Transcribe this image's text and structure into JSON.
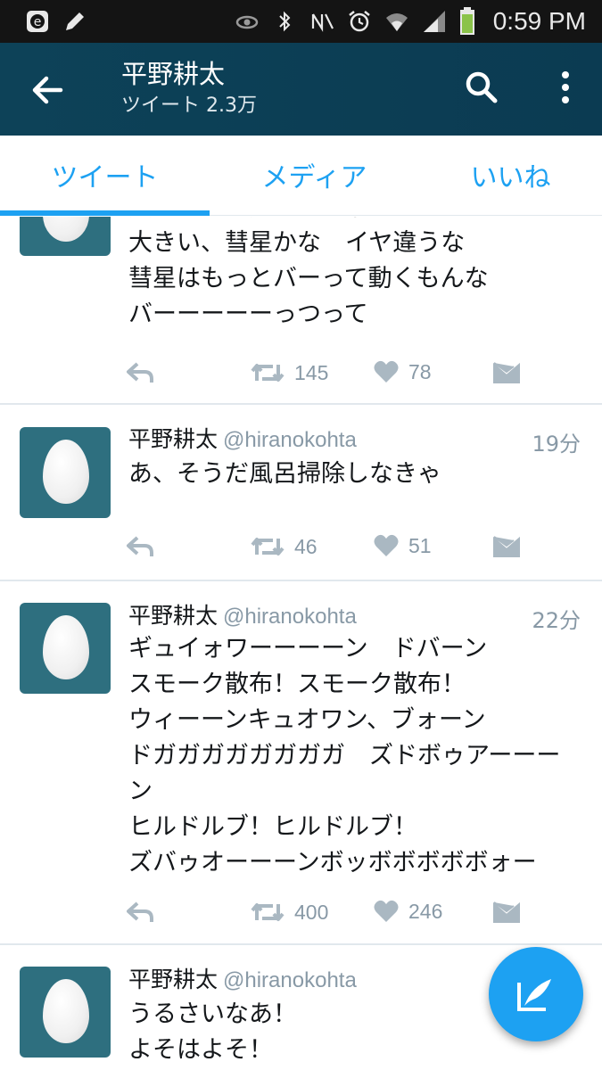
{
  "status_bar": {
    "time": "0:59 PM",
    "icons": [
      "e-app-icon",
      "pencil-icon",
      "eye-icon",
      "bluetooth-icon",
      "nfc-icon",
      "alarm-icon",
      "wifi-icon",
      "signal-icon",
      "battery-icon"
    ],
    "battery_color": "#8bc34a"
  },
  "app_bar": {
    "title": "平野耕太",
    "subtitle": "ツイート 2.3万",
    "background": "#0d4258"
  },
  "tabs": [
    {
      "label": "ツイート",
      "selected": true
    },
    {
      "label": "メディア",
      "selected": false
    },
    {
      "label": "いいね",
      "selected": false
    }
  ],
  "accent_color": "#1da1f2",
  "tweets": [
    {
      "name": "",
      "handle": "",
      "time": "",
      "text": "大きな星が点いたり消えたりしている\n大きい、彗星かな　イヤ違うな\n彗星はもっとバーって動くもんな\nバーーーーーっつって",
      "retweets": "145",
      "likes": "78"
    },
    {
      "name": "平野耕太",
      "handle": "@hiranokohta",
      "time": "19分",
      "text": "あ、そうだ風呂掃除しなきゃ",
      "retweets": "46",
      "likes": "51"
    },
    {
      "name": "平野耕太",
      "handle": "@hiranokohta",
      "time": "22分",
      "text": "ギュイォワーーーーン　ドバーン\nスモーク散布！スモーク散布！\nウィーーンキュオワン、ブォーン\nドガガガガガガガガ　ズドボゥアーーー\nン\nヒルドルブ！ヒルドルブ！\nズバゥオーーーンボッボボボボボォー",
      "retweets": "400",
      "likes": "246"
    },
    {
      "name": "平野耕太",
      "handle": "@hiranokohta",
      "time": "",
      "text": "うるさいなあ！\nよそはよそ！",
      "retweets": "",
      "likes": ""
    }
  ],
  "fab": {
    "icon": "compose-tweet-icon"
  }
}
